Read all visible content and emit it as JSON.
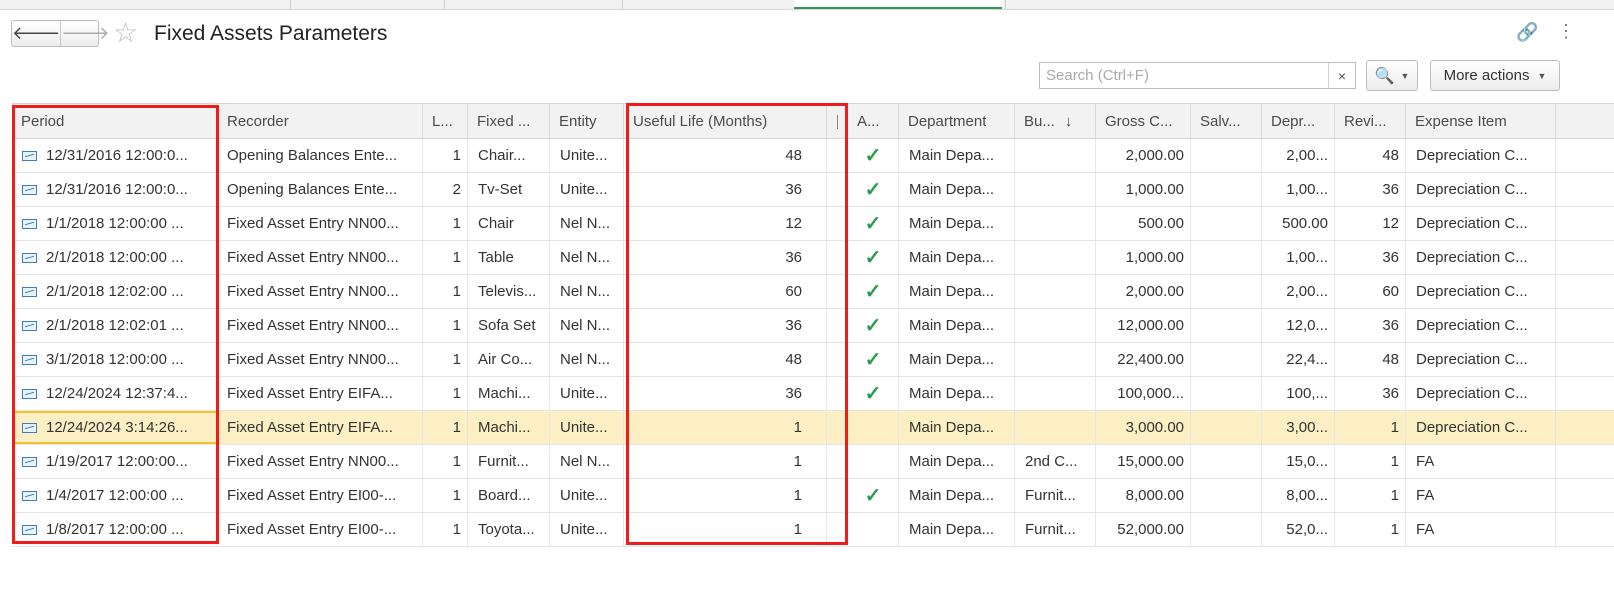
{
  "window": {
    "title": "Fixed Assets Parameters",
    "search_placeholder": "Search (Ctrl+F)",
    "search_clear": "×",
    "more_actions": "More actions",
    "nav_back": "🡐",
    "nav_forward": "🡒"
  },
  "columns": [
    "Period",
    "Recorder",
    "L...",
    "Fixed ...",
    "Entity",
    "Useful Life (Months)",
    "|",
    "A...",
    "Department",
    "Bu...",
    "Gross C...",
    "Salv...",
    "Depr...",
    "Revi...",
    "Expense Item"
  ],
  "sort_indicator": "↓",
  "rows": [
    {
      "period": "12/31/2016 12:00:0...",
      "recorder": "Opening Balances Ente...",
      "line": "1",
      "fixed": "Chair...",
      "entity": "Unite...",
      "useful": "48",
      "a": true,
      "dept": "Main Depa...",
      "bu": "",
      "gross": "2,000.00",
      "salv": "",
      "depr": "2,00...",
      "revi": "48",
      "expense": "Depreciation C..."
    },
    {
      "period": "12/31/2016 12:00:0...",
      "recorder": "Opening Balances Ente...",
      "line": "2",
      "fixed": "Tv-Set",
      "entity": "Unite...",
      "useful": "36",
      "a": true,
      "dept": "Main Depa...",
      "bu": "",
      "gross": "1,000.00",
      "salv": "",
      "depr": "1,00...",
      "revi": "36",
      "expense": "Depreciation C..."
    },
    {
      "period": "1/1/2018 12:00:00 ...",
      "recorder": "Fixed Asset Entry NN00...",
      "line": "1",
      "fixed": "Chair",
      "entity": "Nel N...",
      "useful": "12",
      "a": true,
      "dept": "Main Depa...",
      "bu": "",
      "gross": "500.00",
      "salv": "",
      "depr": "500.00",
      "revi": "12",
      "expense": "Depreciation C..."
    },
    {
      "period": "2/1/2018 12:00:00 ...",
      "recorder": "Fixed Asset Entry NN00...",
      "line": "1",
      "fixed": "Table",
      "entity": "Nel N...",
      "useful": "36",
      "a": true,
      "dept": "Main Depa...",
      "bu": "",
      "gross": "1,000.00",
      "salv": "",
      "depr": "1,00...",
      "revi": "36",
      "expense": "Depreciation C..."
    },
    {
      "period": "2/1/2018 12:02:00 ...",
      "recorder": "Fixed Asset Entry NN00...",
      "line": "1",
      "fixed": "Televis...",
      "entity": "Nel N...",
      "useful": "60",
      "a": true,
      "dept": "Main Depa...",
      "bu": "",
      "gross": "2,000.00",
      "salv": "",
      "depr": "2,00...",
      "revi": "60",
      "expense": "Depreciation C..."
    },
    {
      "period": "2/1/2018 12:02:01 ...",
      "recorder": "Fixed Asset Entry NN00...",
      "line": "1",
      "fixed": "Sofa Set",
      "entity": "Nel N...",
      "useful": "36",
      "a": true,
      "dept": "Main Depa...",
      "bu": "",
      "gross": "12,000.00",
      "salv": "",
      "depr": "12,0...",
      "revi": "36",
      "expense": "Depreciation C..."
    },
    {
      "period": "3/1/2018 12:00:00 ...",
      "recorder": "Fixed Asset Entry NN00...",
      "line": "1",
      "fixed": "Air Co...",
      "entity": "Nel N...",
      "useful": "48",
      "a": true,
      "dept": "Main Depa...",
      "bu": "",
      "gross": "22,400.00",
      "salv": "",
      "depr": "22,4...",
      "revi": "48",
      "expense": "Depreciation C..."
    },
    {
      "period": "12/24/2024 12:37:4...",
      "recorder": "Fixed Asset Entry EIFA...",
      "line": "1",
      "fixed": "Machi...",
      "entity": "Unite...",
      "useful": "36",
      "a": true,
      "dept": "Main Depa...",
      "bu": "",
      "gross": "100,000...",
      "salv": "",
      "depr": "100,...",
      "revi": "36",
      "expense": "Depreciation C..."
    },
    {
      "period": "12/24/2024 3:14:26...",
      "recorder": "Fixed Asset Entry EIFA...",
      "line": "1",
      "fixed": "Machi...",
      "entity": "Unite...",
      "useful": "1",
      "a": false,
      "dept": "Main Depa...",
      "bu": "",
      "gross": "3,000.00",
      "salv": "",
      "depr": "3,00...",
      "revi": "1",
      "expense": "Depreciation C...",
      "selected": true
    },
    {
      "period": "1/19/2017 12:00:00...",
      "recorder": "Fixed Asset Entry NN00...",
      "line": "1",
      "fixed": "Furnit...",
      "entity": "Nel N...",
      "useful": "1",
      "a": false,
      "dept": "Main Depa...",
      "bu": "2nd C...",
      "gross": "15,000.00",
      "salv": "",
      "depr": "15,0...",
      "revi": "1",
      "expense": "FA"
    },
    {
      "period": "1/4/2017 12:00:00 ...",
      "recorder": "Fixed Asset Entry EI00-...",
      "line": "1",
      "fixed": "Board...",
      "entity": "Unite...",
      "useful": "1",
      "a": true,
      "dept": "Main Depa...",
      "bu": "Furnit...",
      "gross": "8,000.00",
      "salv": "",
      "depr": "8,00...",
      "revi": "1",
      "expense": "FA"
    },
    {
      "period": "1/8/2017 12:00:00 ...",
      "recorder": "Fixed Asset Entry EI00-...",
      "line": "1",
      "fixed": "Toyota...",
      "entity": "Unite...",
      "useful": "1",
      "a": false,
      "dept": "Main Depa...",
      "bu": "Furnit...",
      "gross": "52,000.00",
      "salv": "",
      "depr": "52,0...",
      "revi": "1",
      "expense": "FA"
    }
  ],
  "colors": {
    "accent_green": "#2e9c4f",
    "selected_row": "#fcefc4",
    "annotation_red": "#ef1c1c",
    "search_blue": "#1e6fc7"
  }
}
